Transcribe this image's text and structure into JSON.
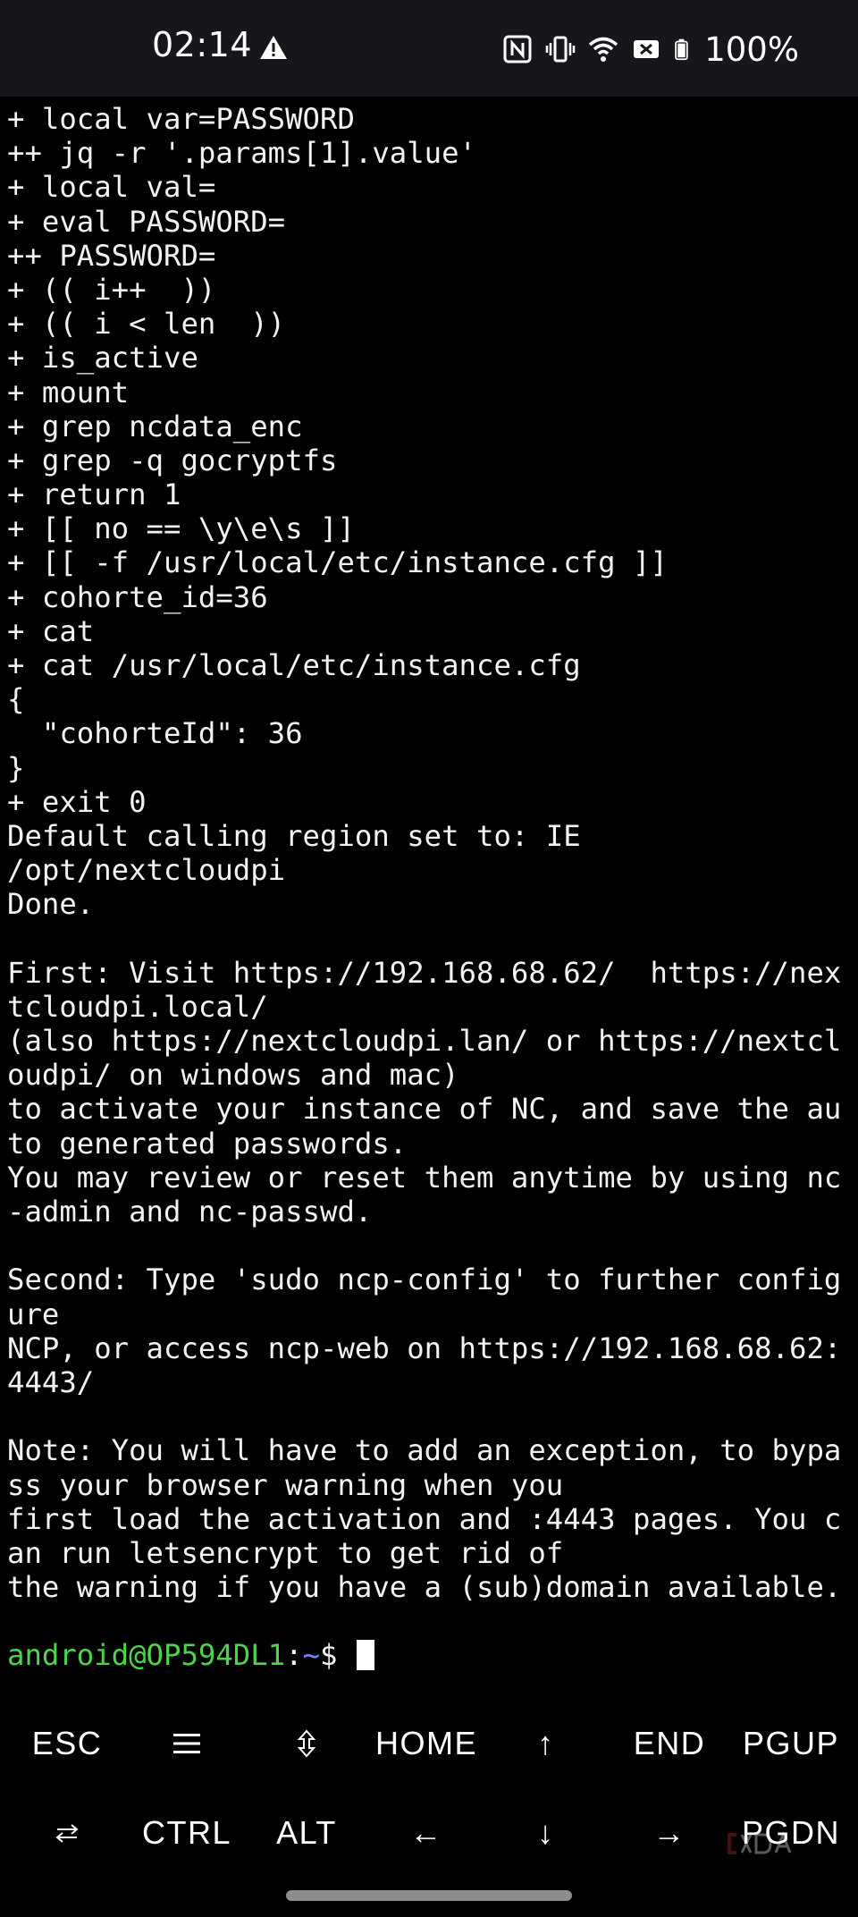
{
  "status_bar": {
    "time": "02:14",
    "left_icons": [
      "alert-triangle-icon"
    ],
    "right_icons": [
      "nfc-icon",
      "vibrate-icon",
      "wifi-icon",
      "data-off-icon",
      "battery-icon"
    ],
    "battery_percent": "100%"
  },
  "terminal": {
    "lines": [
      "+ local var=PASSWORD",
      "++ jq -r '.params[1].value'",
      "+ local val=",
      "+ eval PASSWORD=",
      "++ PASSWORD=",
      "+ (( i++  ))",
      "+ (( i < len  ))",
      "+ is_active",
      "+ mount",
      "+ grep ncdata_enc",
      "+ grep -q gocryptfs",
      "+ return 1",
      "+ [[ no == \\y\\e\\s ]]",
      "+ [[ -f /usr/local/etc/instance.cfg ]]",
      "+ cohorte_id=36",
      "+ cat",
      "+ cat /usr/local/etc/instance.cfg",
      "{",
      "  \"cohorteId\": 36",
      "}",
      "+ exit 0",
      "Default calling region set to: IE",
      "/opt/nextcloudpi",
      "Done.",
      "",
      "First: Visit https://192.168.68.62/  https://nex",
      "tcloudpi.local/",
      "(also https://nextcloudpi.lan/ or https://nextcl",
      "oudpi/ on windows and mac)",
      "to activate your instance of NC, and save the au",
      "to generated passwords.",
      "You may review or reset them anytime by using nc",
      "-admin and nc-passwd.",
      "",
      "Second: Type 'sudo ncp-config' to further config",
      "ure",
      "NCP, or access ncp-web on https://192.168.68.62:",
      "4443/",
      "",
      "Note: You will have to add an exception, to bypa",
      "ss your browser warning when you",
      "first load the activation and :4443 pages. You c",
      "an run letsencrypt to get rid of",
      "the warning if you have a (sub)domain available.",
      ""
    ],
    "prompt": {
      "user_host": "android@OP594DL1",
      "colon": ":",
      "path": "~",
      "dollar": "$ "
    }
  },
  "extra_keys": {
    "row1": [
      {
        "label": "ESC",
        "icon": null
      },
      {
        "label": "",
        "icon": "drawer-menu-icon"
      },
      {
        "label": "",
        "icon": "updown-arrows-icon"
      },
      {
        "label": "HOME",
        "icon": null
      },
      {
        "label": "↑",
        "icon": "arrow-up-icon"
      },
      {
        "label": "END",
        "icon": null
      },
      {
        "label": "PGUP",
        "icon": null
      }
    ],
    "row2": [
      {
        "label": "",
        "icon": "tab-arrows-icon"
      },
      {
        "label": "CTRL",
        "icon": null
      },
      {
        "label": "ALT",
        "icon": null
      },
      {
        "label": "←",
        "icon": "arrow-left-icon"
      },
      {
        "label": "↓",
        "icon": "arrow-down-icon"
      },
      {
        "label": "→",
        "icon": "arrow-right-icon"
      },
      {
        "label": "PGDN",
        "icon": null
      }
    ]
  },
  "watermark": {
    "icon": "xda-logo-icon"
  },
  "colors": {
    "background": "#000000",
    "status_bar": "#15171a",
    "prompt_user": "#4fd34a",
    "prompt_path": "#6b8cff",
    "text": "#f2f2f2"
  }
}
